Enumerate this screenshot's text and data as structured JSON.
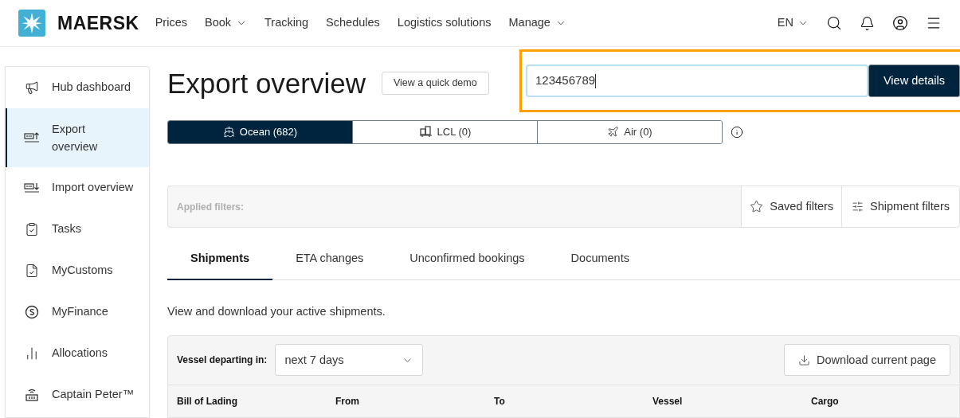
{
  "header": {
    "brand": "MAERSK",
    "nav": [
      {
        "label": "Prices",
        "has_menu": false
      },
      {
        "label": "Book",
        "has_menu": true
      },
      {
        "label": "Tracking",
        "has_menu": false
      },
      {
        "label": "Schedules",
        "has_menu": false
      },
      {
        "label": "Logistics solutions",
        "has_menu": false
      },
      {
        "label": "Manage",
        "has_menu": true
      }
    ],
    "language": "EN"
  },
  "sidebar": {
    "items": [
      {
        "label": "Hub dashboard",
        "kind": "megaphone",
        "selected": false
      },
      {
        "label": "Export overview",
        "kind": "export",
        "selected": true
      },
      {
        "label": "Import overview",
        "kind": "import",
        "selected": false
      },
      {
        "label": "Tasks",
        "kind": "tasks",
        "selected": false
      },
      {
        "label": "MyCustoms",
        "kind": "customs",
        "selected": false
      },
      {
        "label": "MyFinance",
        "kind": "finance",
        "selected": false
      },
      {
        "label": "Allocations",
        "kind": "chart",
        "selected": false
      },
      {
        "label": "Captain Peter™",
        "kind": "container",
        "selected": false
      }
    ]
  },
  "page": {
    "title": "Export overview",
    "demo_button": "View a quick demo"
  },
  "lookup": {
    "value": "123456789",
    "button": "View details",
    "highlighted": true
  },
  "modes": [
    {
      "label": "Ocean (682)",
      "kind": "ship",
      "selected": true
    },
    {
      "label": "LCL (0)",
      "kind": "boxes",
      "selected": false
    },
    {
      "label": "Air (0)",
      "kind": "plane",
      "selected": false
    }
  ],
  "filters": {
    "label": "Applied filters:",
    "saved": "Saved filters",
    "shipment": "Shipment filters"
  },
  "tabs": [
    {
      "label": "Shipments",
      "selected": true
    },
    {
      "label": "ETA changes",
      "selected": false
    },
    {
      "label": "Unconfirmed bookings",
      "selected": false
    },
    {
      "label": "Documents",
      "selected": false
    }
  ],
  "description": "View and download your active shipments.",
  "table": {
    "filter_label": "Vessel departing in:",
    "filter_value": "next 7 days",
    "download": "Download current page",
    "columns": [
      "Bill of Lading",
      "From",
      "To",
      "Vessel",
      "Cargo"
    ]
  }
}
